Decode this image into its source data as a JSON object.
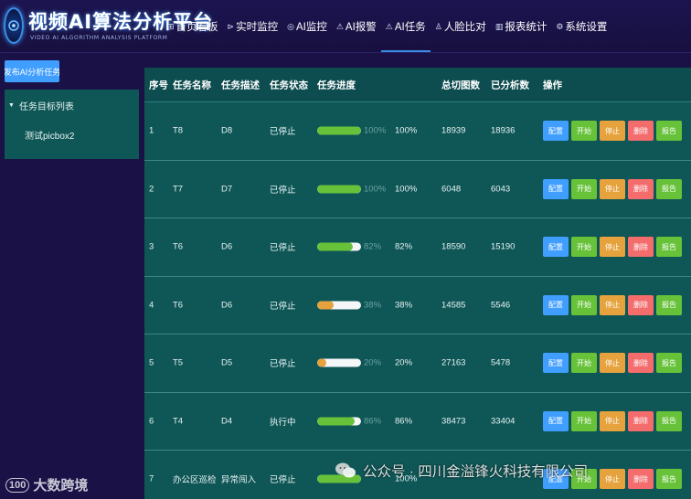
{
  "app": {
    "title": "视频AI算法分析平台",
    "subtitle": "VIDEO AI ALGORITHM ANALYSIS PLATFORM"
  },
  "nav": [
    {
      "icon": "dashboard-icon",
      "glyph": "⊞",
      "label": "首页看板"
    },
    {
      "icon": "live-monitor-icon",
      "glyph": "⊳",
      "label": "实时监控"
    },
    {
      "icon": "ai-monitor-icon",
      "glyph": "◎",
      "label": "AI监控"
    },
    {
      "icon": "ai-alarm-icon",
      "glyph": "⚠",
      "label": "AI报警"
    },
    {
      "icon": "ai-task-icon",
      "glyph": "⚠",
      "label": "AI任务",
      "active": true
    },
    {
      "icon": "face-compare-icon",
      "glyph": "♙",
      "label": "人脸比对"
    },
    {
      "icon": "report-icon",
      "glyph": "▥",
      "label": "报表统计"
    },
    {
      "icon": "settings-icon",
      "glyph": "⚙",
      "label": "系统设置"
    }
  ],
  "sidebar": {
    "publish_label": "发布AI分析任务",
    "tree_root": "任务目标列表",
    "tree_child": "测试picbox2"
  },
  "table": {
    "headers": {
      "idx": "序号",
      "name": "任务名称",
      "desc": "任务描述",
      "status": "任务状态",
      "progress": "任务进度",
      "total": "总切图数",
      "done": "已分析数",
      "ops": "操作"
    },
    "buttons": {
      "config": "配置",
      "start": "开始",
      "stop": "停止",
      "delete": "删除",
      "report": "报告"
    },
    "rows": [
      {
        "idx": "1",
        "name": "T8",
        "desc": "D8",
        "status": "已停止",
        "progress": 100,
        "bar_label": "100%",
        "pct": "100%",
        "total": "18939",
        "done": "18936",
        "color": "#67c23a"
      },
      {
        "idx": "2",
        "name": "T7",
        "desc": "D7",
        "status": "已停止",
        "progress": 100,
        "bar_label": "100%",
        "pct": "100%",
        "total": "6048",
        "done": "6043",
        "color": "#67c23a"
      },
      {
        "idx": "3",
        "name": "T6",
        "desc": "D6",
        "status": "已停止",
        "progress": 82,
        "bar_label": "82%",
        "pct": "82%",
        "total": "18590",
        "done": "15190",
        "color": "#67c23a"
      },
      {
        "idx": "4",
        "name": "T6",
        "desc": "D6",
        "status": "已停止",
        "progress": 38,
        "bar_label": "38%",
        "pct": "38%",
        "total": "14585",
        "done": "5546",
        "color": "#e6a23c"
      },
      {
        "idx": "5",
        "name": "T5",
        "desc": "D5",
        "status": "已停止",
        "progress": 20,
        "bar_label": "20%",
        "pct": "20%",
        "total": "27163",
        "done": "5478",
        "color": "#e6a23c"
      },
      {
        "idx": "6",
        "name": "T4",
        "desc": "D4",
        "status": "执行中",
        "progress": 86,
        "bar_label": "86%",
        "pct": "86%",
        "total": "38473",
        "done": "33404",
        "color": "#67c23a"
      },
      {
        "idx": "7",
        "name": "办公区巡检",
        "desc": "异常闯入",
        "status": "已停止",
        "progress": 100,
        "bar_label": "",
        "pct": "100%",
        "total": "",
        "done": "",
        "color": "#67c23a"
      }
    ]
  },
  "watermark": {
    "left": "大数跨境",
    "left_logo": "100",
    "right": "公众号 · 四川金溢锋火科技有限公司"
  }
}
